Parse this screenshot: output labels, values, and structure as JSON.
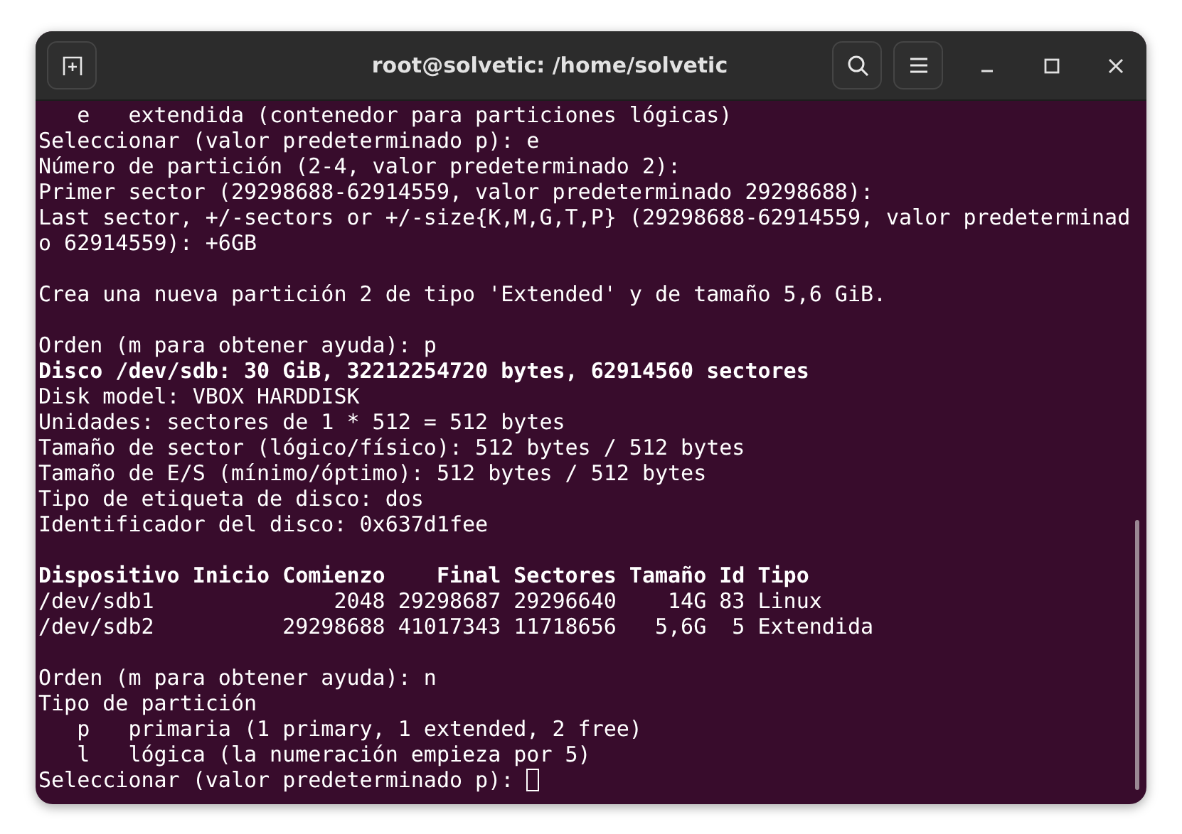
{
  "window": {
    "title": "root@solvetic: /home/solvetic"
  },
  "lines": [
    {
      "kind": "text",
      "text": "   e   extendida (contenedor para particiones lógicas)",
      "bold": false
    },
    {
      "kind": "text",
      "text": "Seleccionar (valor predeterminado p): e",
      "bold": false
    },
    {
      "kind": "text",
      "text": "Número de partición (2-4, valor predeterminado 2):",
      "bold": false
    },
    {
      "kind": "text",
      "text": "Primer sector (29298688-62914559, valor predeterminado 29298688):",
      "bold": false
    },
    {
      "kind": "text",
      "text": "Last sector, +/-sectors or +/-size{K,M,G,T,P} (29298688-62914559, valor predeterminad",
      "bold": false
    },
    {
      "kind": "text",
      "text": "o 62914559): +6GB",
      "bold": false
    },
    {
      "kind": "blank"
    },
    {
      "kind": "text",
      "text": "Crea una nueva partición 2 de tipo 'Extended' y de tamaño 5,6 GiB.",
      "bold": false
    },
    {
      "kind": "blank"
    },
    {
      "kind": "text",
      "text": "Orden (m para obtener ayuda): p",
      "bold": false
    },
    {
      "kind": "text",
      "text": "Disco /dev/sdb: 30 GiB, 32212254720 bytes, 62914560 sectores",
      "bold": true
    },
    {
      "kind": "text",
      "text": "Disk model: VBOX HARDDISK",
      "bold": false
    },
    {
      "kind": "text",
      "text": "Unidades: sectores de 1 * 512 = 512 bytes",
      "bold": false
    },
    {
      "kind": "text",
      "text": "Tamaño de sector (lógico/físico): 512 bytes / 512 bytes",
      "bold": false
    },
    {
      "kind": "text",
      "text": "Tamaño de E/S (mínimo/óptimo): 512 bytes / 512 bytes",
      "bold": false
    },
    {
      "kind": "text",
      "text": "Tipo de etiqueta de disco: dos",
      "bold": false
    },
    {
      "kind": "text",
      "text": "Identificador del disco: 0x637d1fee",
      "bold": false
    },
    {
      "kind": "blank"
    },
    {
      "kind": "text",
      "text": "Dispositivo Inicio Comienzo    Final Sectores Tamaño Id Tipo",
      "bold": true
    },
    {
      "kind": "text",
      "text": "/dev/sdb1              2048 29298687 29296640    14G 83 Linux",
      "bold": false
    },
    {
      "kind": "text",
      "text": "/dev/sdb2          29298688 41017343 11718656   5,6G  5 Extendida",
      "bold": false
    },
    {
      "kind": "blank"
    },
    {
      "kind": "text",
      "text": "Orden (m para obtener ayuda): n",
      "bold": false
    },
    {
      "kind": "text",
      "text": "Tipo de partición",
      "bold": false
    },
    {
      "kind": "text",
      "text": "   p   primaria (1 primary, 1 extended, 2 free)",
      "bold": false
    },
    {
      "kind": "text",
      "text": "   l   lógica (la numeración empieza por 5)",
      "bold": false
    },
    {
      "kind": "prompt",
      "text": "Seleccionar (valor predeterminado p): ",
      "bold": false
    }
  ]
}
